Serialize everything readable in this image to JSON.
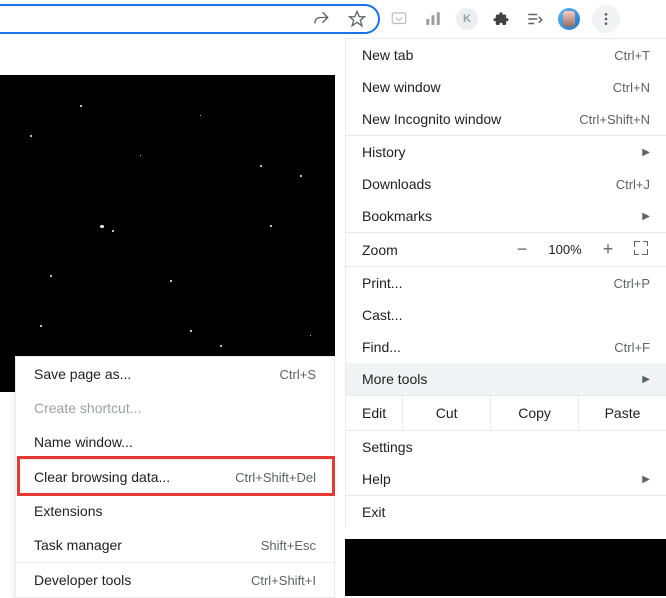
{
  "toolbar": {
    "share_icon": "share-icon",
    "star_icon": "bookmark-star-icon",
    "ext_pocket": "P",
    "ext_bars": "bars",
    "ext_k": "K",
    "ext_puzzle": "puzzle",
    "ext_playlist": "playlist",
    "avatar": "user-avatar",
    "kebab": "kebab"
  },
  "main_menu": {
    "new_tab": {
      "label": "New tab",
      "shortcut": "Ctrl+T"
    },
    "new_window": {
      "label": "New window",
      "shortcut": "Ctrl+N"
    },
    "new_incognito": {
      "label": "New Incognito window",
      "shortcut": "Ctrl+Shift+N"
    },
    "history": {
      "label": "History"
    },
    "downloads": {
      "label": "Downloads",
      "shortcut": "Ctrl+J"
    },
    "bookmarks": {
      "label": "Bookmarks"
    },
    "zoom_label": "Zoom",
    "zoom_minus": "−",
    "zoom_pct": "100%",
    "zoom_plus": "+",
    "print": {
      "label": "Print...",
      "shortcut": "Ctrl+P"
    },
    "cast": {
      "label": "Cast..."
    },
    "find": {
      "label": "Find...",
      "shortcut": "Ctrl+F"
    },
    "more_tools": {
      "label": "More tools"
    },
    "edit_label": "Edit",
    "cut": "Cut",
    "copy": "Copy",
    "paste": "Paste",
    "settings": {
      "label": "Settings"
    },
    "help": {
      "label": "Help"
    },
    "exit": {
      "label": "Exit"
    }
  },
  "sub_menu": {
    "save_page": {
      "label": "Save page as...",
      "shortcut": "Ctrl+S"
    },
    "create_shortcut": {
      "label": "Create shortcut..."
    },
    "name_window": {
      "label": "Name window..."
    },
    "clear_browsing": {
      "label": "Clear browsing data...",
      "shortcut": "Ctrl+Shift+Del"
    },
    "extensions": {
      "label": "Extensions"
    },
    "task_manager": {
      "label": "Task manager",
      "shortcut": "Shift+Esc"
    },
    "developer_tools": {
      "label": "Developer tools",
      "shortcut": "Ctrl+Shift+I"
    }
  }
}
